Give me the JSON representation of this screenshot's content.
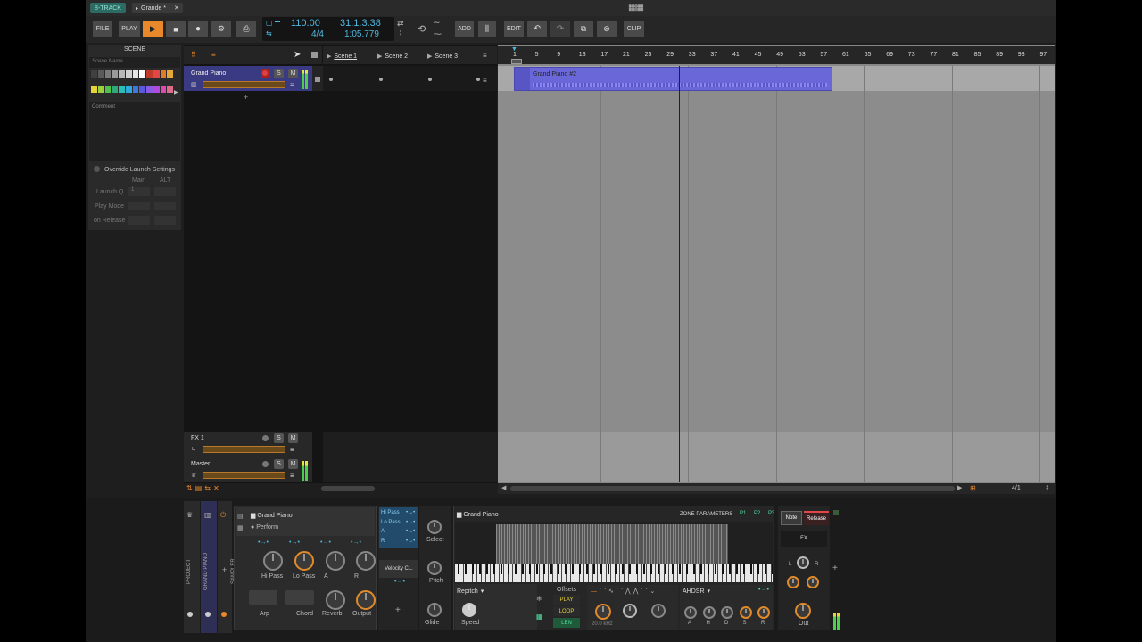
{
  "tabs": [
    {
      "label": "8-TRACK"
    },
    {
      "label": "Grande *"
    }
  ],
  "toolbar": {
    "file": "FILE",
    "play": "PLAY",
    "add": "ADD",
    "edit": "EDIT",
    "clip": "CLIP"
  },
  "transport": {
    "tempo": "110.00",
    "signature": "4/4",
    "position": "31.1.3.38",
    "time": "1:05.779"
  },
  "inspector": {
    "title": "SCENE",
    "scene_name_placeholder": "Scene Name",
    "comment": "Comment",
    "override": "Override Launch Settings",
    "main": "Main",
    "alt": "ALT",
    "rows": [
      {
        "label": "Launch Q",
        "value": "1"
      },
      {
        "label": "Play Mode",
        "value": ""
      },
      {
        "label": "on Release",
        "value": ""
      }
    ],
    "colors": [
      "#404040",
      "#5a5a5a",
      "#7a7a7a",
      "#9a9a9a",
      "#b8b8b8",
      "#d0d0d0",
      "#e5e5e5",
      "#ffffff",
      "#c0392b",
      "#e04848",
      "#e07b28",
      "#e8a838",
      "#e6d33a",
      "#9bd13a",
      "#4fc04a",
      "#2fa87a",
      "#27c0b8",
      "#2fa8e0",
      "#3a7ae0",
      "#5a5ae0",
      "#8a5ae0",
      "#b04ae0",
      "#e04ab0",
      "#e06a8a"
    ]
  },
  "tracks": [
    {
      "name": "Grand Piano"
    },
    {
      "name": "FX 1"
    },
    {
      "name": "Master"
    }
  ],
  "scenes": [
    "Scene 1",
    "Scene 2",
    "Scene 3"
  ],
  "solo": "S",
  "mute": "M",
  "ruler": [
    "1",
    "5",
    "9",
    "13",
    "17",
    "21",
    "25",
    "29",
    "33",
    "37",
    "41",
    "45",
    "49",
    "53",
    "57",
    "61",
    "65",
    "69",
    "73",
    "77",
    "81",
    "85",
    "89",
    "93",
    "97"
  ],
  "clip": {
    "name": "Grand Piano #2",
    "color": "#6a68d8"
  },
  "zoom": "4/1",
  "device": {
    "side_labels": [
      "PROJECT",
      "GRAND PIANO",
      "SAMPLER"
    ],
    "preset": "Grand Piano",
    "mode": "Perform",
    "knobs": [
      "Hi Pass",
      "Lo Pass",
      "A",
      "R"
    ],
    "buttons": [
      "Arp",
      "Chord"
    ],
    "knobs2": [
      "Reverb",
      "Output"
    ],
    "mod_list": [
      "Hi Pass",
      "Lo Pass",
      "A",
      "R"
    ],
    "select": "Select",
    "pitch": "Pitch",
    "glide": "Glide",
    "velocity": "Velocity C...",
    "sampler_title": "Grand Piano",
    "zone": "ZONE PARAMETERS",
    "zone_buttons": [
      "P1",
      "P2",
      "P3"
    ],
    "note": "Note",
    "release": "Release",
    "fx": "FX",
    "repitch": "Repitch",
    "speed": "Speed",
    "offsets": "Offsets",
    "play": "PLAY",
    "loop": "LOOP",
    "len": "LEN",
    "freq": "20.0 kHz",
    "ahdsr": "AHDSR",
    "env": [
      "A",
      "H",
      "D",
      "S",
      "R"
    ],
    "out": "Out",
    "l": "L",
    "r": "R"
  }
}
